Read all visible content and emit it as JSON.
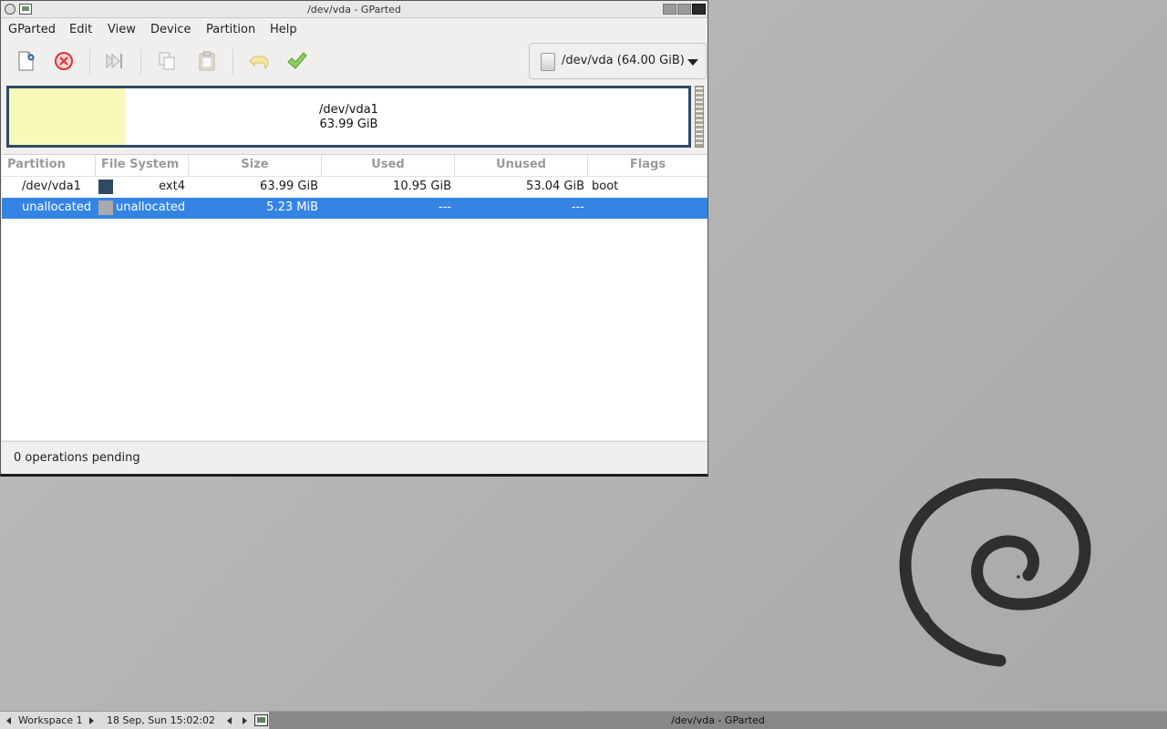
{
  "window": {
    "title": "/dev/vda - GParted"
  },
  "menu": [
    "GParted",
    "Edit",
    "View",
    "Device",
    "Partition",
    "Help"
  ],
  "toolbar": {
    "icons": [
      "new-icon",
      "delete-icon",
      "resize-move-icon",
      "copy-icon",
      "paste-icon",
      "undo-icon",
      "apply-icon"
    ],
    "device_selector": "/dev/vda (64.00 GiB)"
  },
  "disk_graph": {
    "partition_name": "/dev/vda1",
    "partition_size": "63.99 GiB",
    "used_fraction": 0.171,
    "used_color": "#f8f8b8",
    "border_color": "#2e4a66"
  },
  "table": {
    "headers": [
      "Partition",
      "File System",
      "Size",
      "Used",
      "Unused",
      "Flags"
    ],
    "rows": [
      {
        "partition": "/dev/vda1",
        "fs_color": "#2e4a66",
        "filesystem": "ext4",
        "size": "63.99 GiB",
        "used": "10.95 GiB",
        "unused": "53.04 GiB",
        "flags": "boot"
      },
      {
        "partition": "unallocated",
        "fs_color": "#a9a9a9",
        "filesystem": "unallocated",
        "size": "5.23 MiB",
        "used": "---",
        "unused": "---",
        "flags": ""
      }
    ],
    "selected_color": "#3584e4"
  },
  "status": {
    "text": "0 operations pending"
  },
  "taskbar": {
    "workspace": "Workspace 1",
    "clock": "18 Sep, Sun 15:02:02",
    "window_title": "/dev/vda - GParted"
  }
}
